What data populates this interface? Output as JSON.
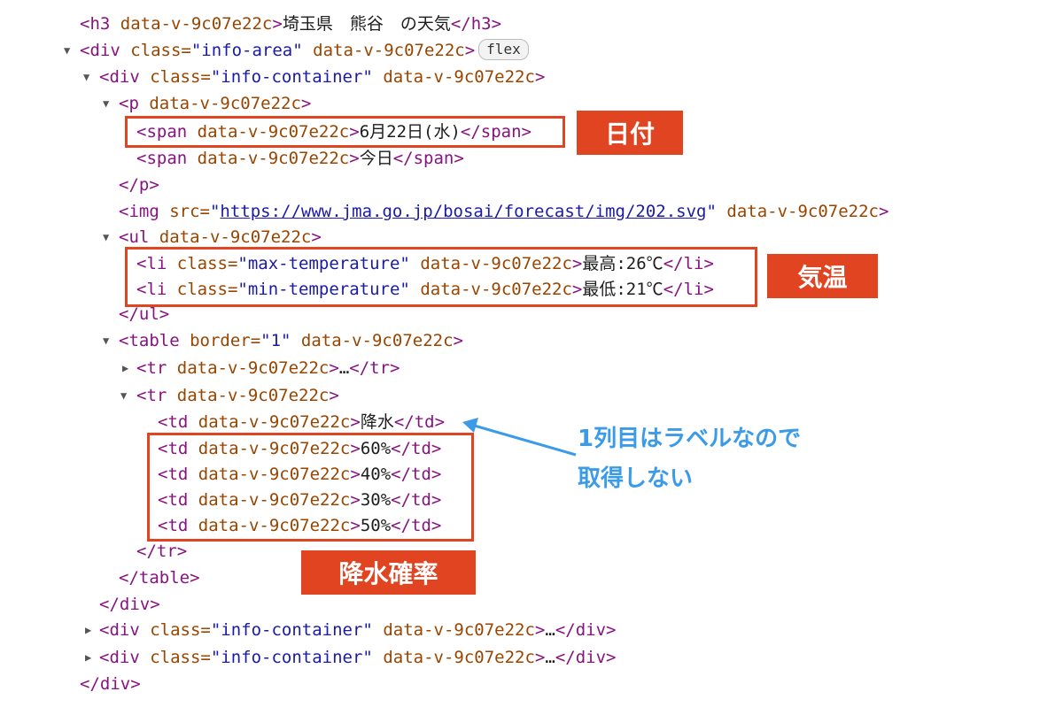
{
  "lines": {
    "h3": {
      "open": "<h3 ",
      "attr": "data-v-9c07e22c",
      "close": ">",
      "text": "埼玉県　熊谷　の天気",
      "end": "</h3>"
    },
    "div_info_area": {
      "open": "<div ",
      "a1": "class=",
      "v1": "\"info-area\"",
      "a2": " data-v-9c07e22c",
      "close": ">",
      "badge": "flex"
    },
    "div_container_1": {
      "open": "<div ",
      "a1": "class=",
      "v1": "\"info-container\"",
      "a2": " data-v-9c07e22c",
      "close": ">"
    },
    "p_open": {
      "open": "<p ",
      "attr": "data-v-9c07e22c",
      "close": ">"
    },
    "span_date": {
      "open": "<span ",
      "attr": "data-v-9c07e22c",
      "close": ">",
      "text": "6月22日(水)",
      "end": "</span>"
    },
    "span_today": {
      "open": "<span ",
      "attr": "data-v-9c07e22c",
      "close": ">",
      "text": "今日",
      "end": "</span>"
    },
    "p_close": "</p>",
    "img": {
      "open": "<img ",
      "a1": "src=",
      "q1": "\"",
      "url": "https://www.jma.go.jp/bosai/forecast/img/202.svg",
      "q2": "\"",
      "a2": " data-v-9c07e22c",
      "close": ">"
    },
    "ul_open": {
      "open": "<ul ",
      "attr": "data-v-9c07e22c",
      "close": ">"
    },
    "li_max": {
      "open": "<li ",
      "a1": "class=",
      "v1": "\"max-temperature\"",
      "a2": " data-v-9c07e22c",
      "close": ">",
      "text": "最高:26℃",
      "end": "</li>"
    },
    "li_min": {
      "open": "<li ",
      "a1": "class=",
      "v1": "\"min-temperature\"",
      "a2": " data-v-9c07e22c",
      "close": ">",
      "text": "最低:21℃",
      "end": "</li>"
    },
    "ul_close": "</ul>",
    "table_open": {
      "open": "<table ",
      "a1": "border=",
      "v1": "\"1\"",
      "a2": " data-v-9c07e22c",
      "close": ">"
    },
    "tr_collapsed": {
      "open": "<tr ",
      "attr": "data-v-9c07e22c",
      "close": ">",
      "text": "…",
      "end": "</tr>"
    },
    "tr_open": {
      "open": "<tr ",
      "attr": "data-v-9c07e22c",
      "close": ">"
    },
    "td_label": {
      "open": "<td ",
      "attr": "data-v-9c07e22c",
      "close": ">",
      "text": "降水",
      "end": "</td>"
    },
    "td_1": {
      "open": "<td ",
      "attr": "data-v-9c07e22c",
      "close": ">",
      "text": "60%",
      "end": "</td>"
    },
    "td_2": {
      "open": "<td ",
      "attr": "data-v-9c07e22c",
      "close": ">",
      "text": "40%",
      "end": "</td>"
    },
    "td_3": {
      "open": "<td ",
      "attr": "data-v-9c07e22c",
      "close": ">",
      "text": "30%",
      "end": "</td>"
    },
    "td_4": {
      "open": "<td ",
      "attr": "data-v-9c07e22c",
      "close": ">",
      "text": "50%",
      "end": "</td>"
    },
    "tr_close": "</tr>",
    "table_close": "</table>",
    "div_close_1": "</div>",
    "div_container_2": {
      "open": "<div ",
      "a1": "class=",
      "v1": "\"info-container\"",
      "a2": " data-v-9c07e22c",
      "close": ">",
      "text": "…",
      "end": "</div>"
    },
    "div_container_3": {
      "open": "<div ",
      "a1": "class=",
      "v1": "\"info-container\"",
      "a2": " data-v-9c07e22c",
      "close": ">",
      "text": "…",
      "end": "</div>"
    },
    "div_close_2": "</div>"
  },
  "annotations": {
    "date_label": "日付",
    "temp_label": "気温",
    "precip_label": "降水確率",
    "note_line1": "1列目はラベルなので",
    "note_line2": "取得しない"
  },
  "colors": {
    "highlight": "#e04420",
    "note": "#3b9be8",
    "tag": "#881280",
    "attr": "#994500",
    "value": "#1a1aa6"
  },
  "icons": {
    "expand": "triangle-down-icon",
    "collapse": "triangle-right-icon"
  }
}
